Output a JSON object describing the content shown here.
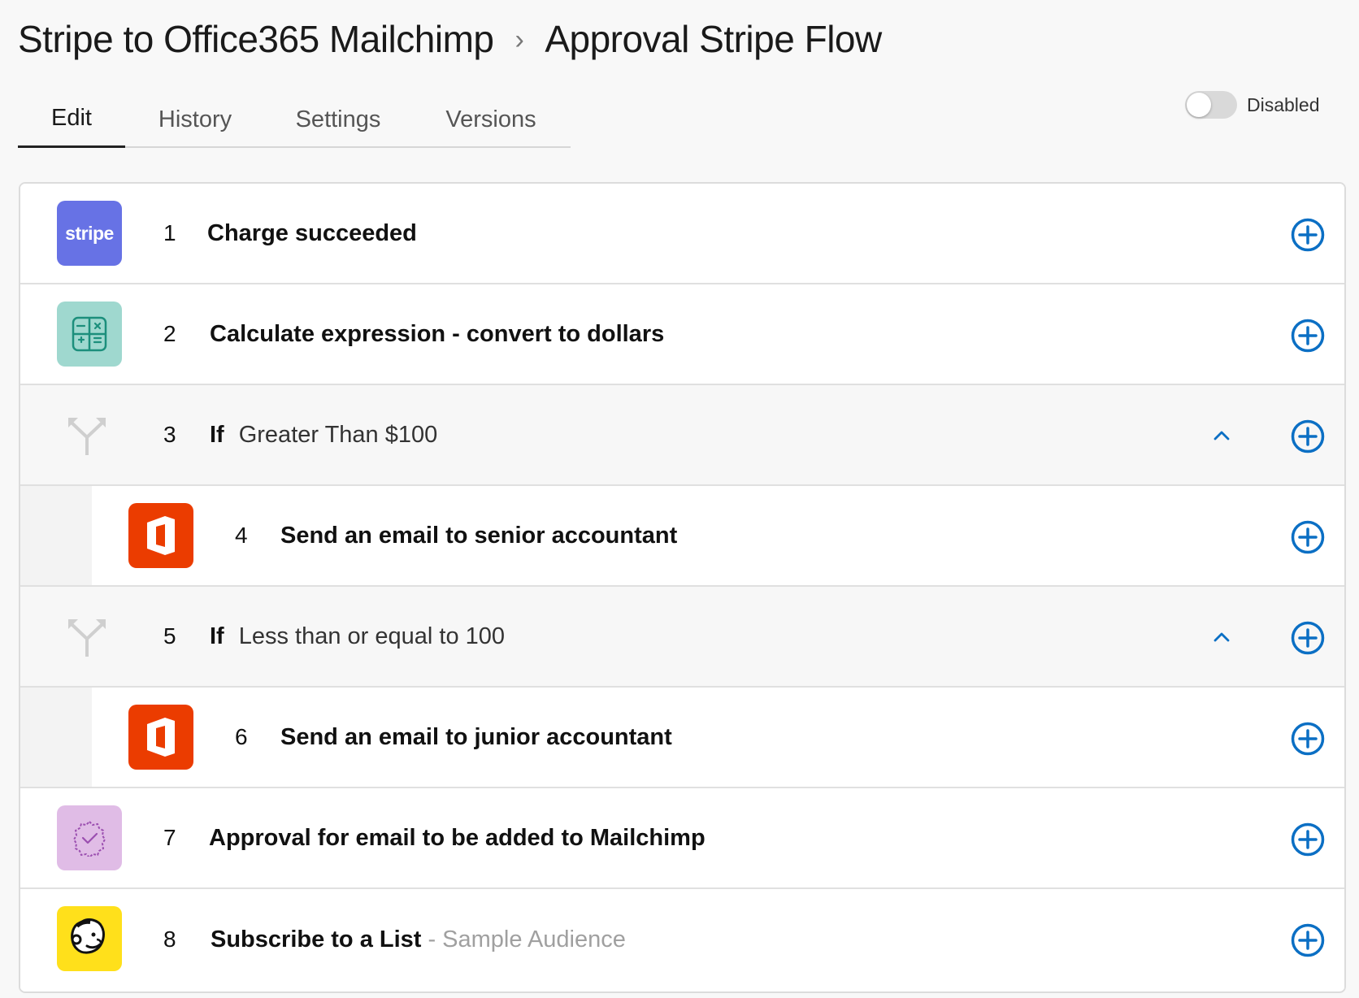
{
  "breadcrumb": {
    "parent": "Stripe to Office365 Mailchimp",
    "separator": "›",
    "current": "Approval Stripe Flow"
  },
  "tabs": [
    {
      "label": "Edit",
      "active": true
    },
    {
      "label": "History",
      "active": false
    },
    {
      "label": "Settings",
      "active": false
    },
    {
      "label": "Versions",
      "active": false
    }
  ],
  "status": {
    "label": "Disabled",
    "enabled": false
  },
  "steps": [
    {
      "number": "1",
      "title": "Charge succeeded",
      "icon": "stripe-logo",
      "logo_text": "stripe",
      "color": "#6772e5"
    },
    {
      "number": "2",
      "title": "Calculate expression - convert to dollars",
      "icon": "calculator-icon",
      "color": "#9fd8cf"
    },
    {
      "number": "3",
      "keyword": "If",
      "condition": "Greater Than $100",
      "icon": "branch-icon",
      "expanded": true
    },
    {
      "number": "4",
      "title": "Send an email to senior accountant",
      "icon": "office365-icon",
      "color": "#eb3c00"
    },
    {
      "number": "5",
      "keyword": "If",
      "condition": "Less than or equal to 100",
      "icon": "branch-icon",
      "expanded": true
    },
    {
      "number": "6",
      "title": "Send an email to junior accountant",
      "icon": "office365-icon",
      "color": "#eb3c00"
    },
    {
      "number": "7",
      "title": "Approval for email to be added to Mailchimp",
      "icon": "approval-badge-icon",
      "color": "#e0bce6"
    },
    {
      "number": "8",
      "title": "Subscribe to a List",
      "subtitle": "- Sample Audience",
      "icon": "mailchimp-icon",
      "color": "#ffe01b"
    }
  ],
  "colors": {
    "accent": "#0b6fc4"
  }
}
